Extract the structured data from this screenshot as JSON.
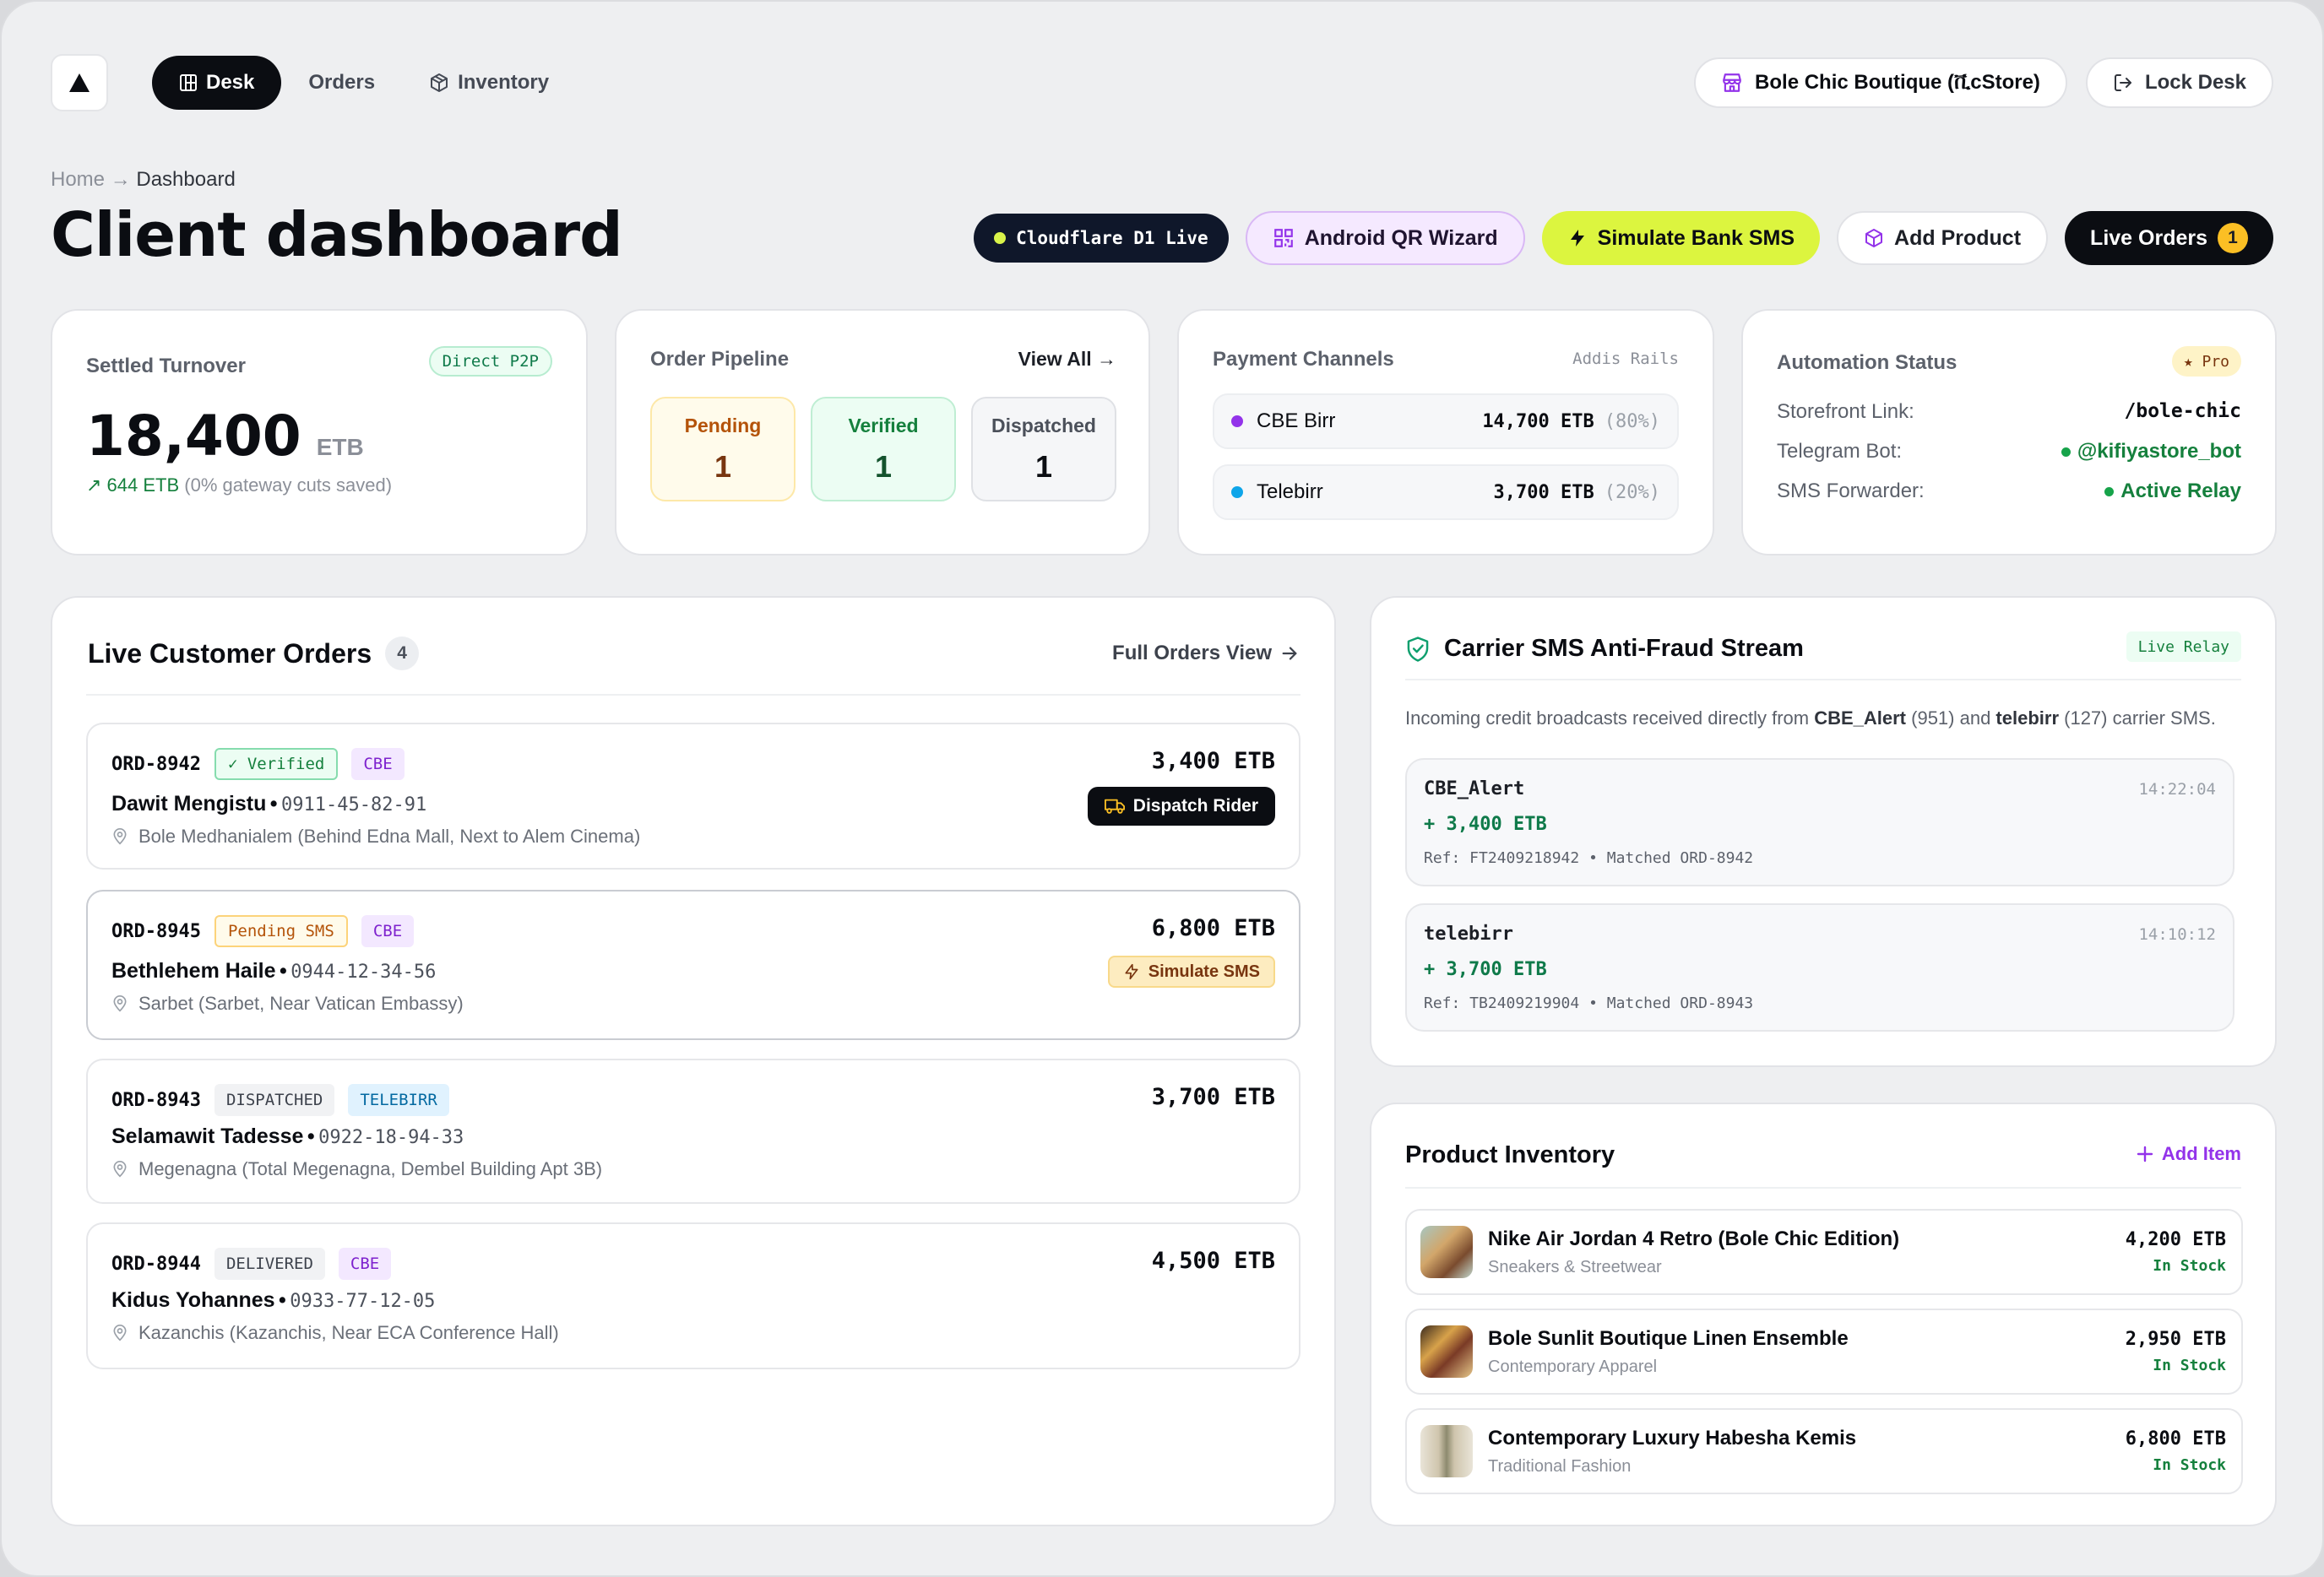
{
  "nav": {
    "tabs": [
      {
        "label": "Desk"
      },
      {
        "label": "Orders"
      },
      {
        "label": "Inventory"
      }
    ],
    "store_label": "Bole Chic Boutique (ቪcStore)",
    "lock_label": "Lock Desk"
  },
  "breadcrumb": {
    "home": "Home",
    "sep": "→",
    "current": "Dashboard"
  },
  "page_title": "Client dashboard",
  "actions": {
    "db_status": "Cloudflare D1 Live",
    "qr_wizard": "Android QR Wizard",
    "simulate_sms": "Simulate Bank SMS",
    "add_product": "Add Product",
    "live_orders": "Live Orders",
    "live_orders_count": "1"
  },
  "turnover": {
    "title": "Settled Turnover",
    "badge": "Direct P2P",
    "value": "18,400",
    "unit": "ETB",
    "saved": "↗ 644 ETB",
    "saved_note": "(0% gateway cuts saved)"
  },
  "pipeline": {
    "title": "Order Pipeline",
    "view_all": "View All →",
    "stages": [
      {
        "label": "Pending",
        "count": "1"
      },
      {
        "label": "Verified",
        "count": "1"
      },
      {
        "label": "Dispatched",
        "count": "1"
      }
    ]
  },
  "channels": {
    "title": "Payment Channels",
    "tag": "Addis Rails",
    "items": [
      {
        "name": "CBE Birr",
        "amount": "14,700 ETB",
        "pct": "(80%)",
        "color": "#9333ea"
      },
      {
        "name": "Telebirr",
        "amount": "3,700 ETB",
        "pct": "(20%)",
        "color": "#0ea5e9"
      }
    ]
  },
  "automation": {
    "title": "Automation Status",
    "badge": "★ Pro",
    "rows": [
      {
        "key": "Storefront Link:",
        "value": "/bole-chic"
      },
      {
        "key": "Telegram Bot:",
        "value": "@kifiyastore_bot"
      },
      {
        "key": "SMS Forwarder:",
        "value": "Active Relay"
      }
    ]
  },
  "orders": {
    "title": "Live Customer Orders",
    "count": "4",
    "full_view": "Full Orders View",
    "items": [
      {
        "id": "ORD-8942",
        "status": "✓ Verified",
        "bank": "CBE",
        "name": "Dawit Mengistu",
        "sep": "•",
        "phone": "0911-45-82-91",
        "address": "Bole Medhanialem (Behind Edna Mall, Next to Alem Cinema)",
        "amount": "3,400 ETB",
        "action": "Dispatch Rider"
      },
      {
        "id": "ORD-8945",
        "status": "Pending SMS",
        "bank": "CBE",
        "name": "Bethlehem Haile",
        "sep": "•",
        "phone": "0944-12-34-56",
        "address": "Sarbet (Sarbet, Near Vatican Embassy)",
        "amount": "6,800 ETB",
        "action": "Simulate SMS"
      },
      {
        "id": "ORD-8943",
        "status": "DISPATCHED",
        "bank": "TELEBIRR",
        "name": "Selamawit Tadesse",
        "sep": "•",
        "phone": "0922-18-94-33",
        "address": "Megenagna (Total Megenagna, Dembel Building Apt 3B)",
        "amount": "3,700 ETB"
      },
      {
        "id": "ORD-8944",
        "status": "DELIVERED",
        "bank": "CBE",
        "name": "Kidus Yohannes",
        "sep": "•",
        "phone": "0933-77-12-05",
        "address": "Kazanchis (Kazanchis, Near ECA Conference Hall)",
        "amount": "4,500 ETB"
      }
    ]
  },
  "sms_stream": {
    "title": "Carrier SMS Anti-Fraud Stream",
    "badge": "Live Relay",
    "desc_a": "Incoming credit broadcasts received directly from ",
    "desc_b": "CBE_Alert",
    "desc_c": " (951) and ",
    "desc_d": "telebirr",
    "desc_e": " (127) carrier SMS.",
    "messages": [
      {
        "sender": "CBE_Alert",
        "time": "14:22:04",
        "amount": "+ 3,400 ETB",
        "ref": "Ref: FT2409218942 • Matched ORD-8942"
      },
      {
        "sender": "telebirr",
        "time": "14:10:12",
        "amount": "+ 3,700 ETB",
        "ref": "Ref: TB2409219904 • Matched ORD-8943"
      }
    ]
  },
  "inventory": {
    "title": "Product Inventory",
    "add_item": "Add Item",
    "items": [
      {
        "name": "Nike Air Jordan 4 Retro (Bole Chic Edition)",
        "category": "Sneakers & Streetwear",
        "price": "4,200 ETB",
        "stock": "In Stock"
      },
      {
        "name": "Bole Sunlit Boutique Linen Ensemble",
        "category": "Contemporary Apparel",
        "price": "2,950 ETB",
        "stock": "In Stock"
      },
      {
        "name": "Contemporary Luxury Habesha Kemis",
        "category": "Traditional Fashion",
        "price": "6,800 ETB",
        "stock": "In Stock"
      }
    ]
  }
}
